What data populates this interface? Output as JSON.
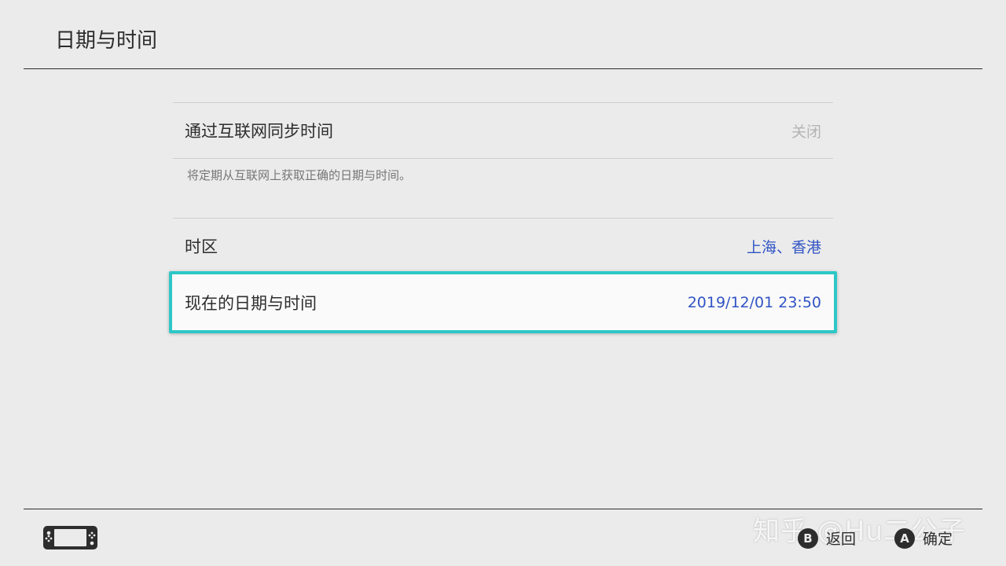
{
  "page_title": "日期与时间",
  "settings": {
    "sync": {
      "label": "通过互联网同步时间",
      "value": "关闭",
      "description": "将定期从互联网上获取正确的日期与时间。"
    },
    "timezone": {
      "label": "时区",
      "value": "上海、香港"
    },
    "current": {
      "label": "现在的日期与时间",
      "value": "2019/12/01 23:50"
    }
  },
  "footer": {
    "console_icon": "handheld-console-icon",
    "watermark": "知乎 @Hu二公子",
    "back": {
      "button": "B",
      "label": "返回"
    },
    "confirm": {
      "button": "A",
      "label": "确定"
    }
  },
  "colors": {
    "accent": "#2ec7c7",
    "value_blue": "#3154c4",
    "background": "#ebebeb",
    "text": "#2d2d2d"
  }
}
